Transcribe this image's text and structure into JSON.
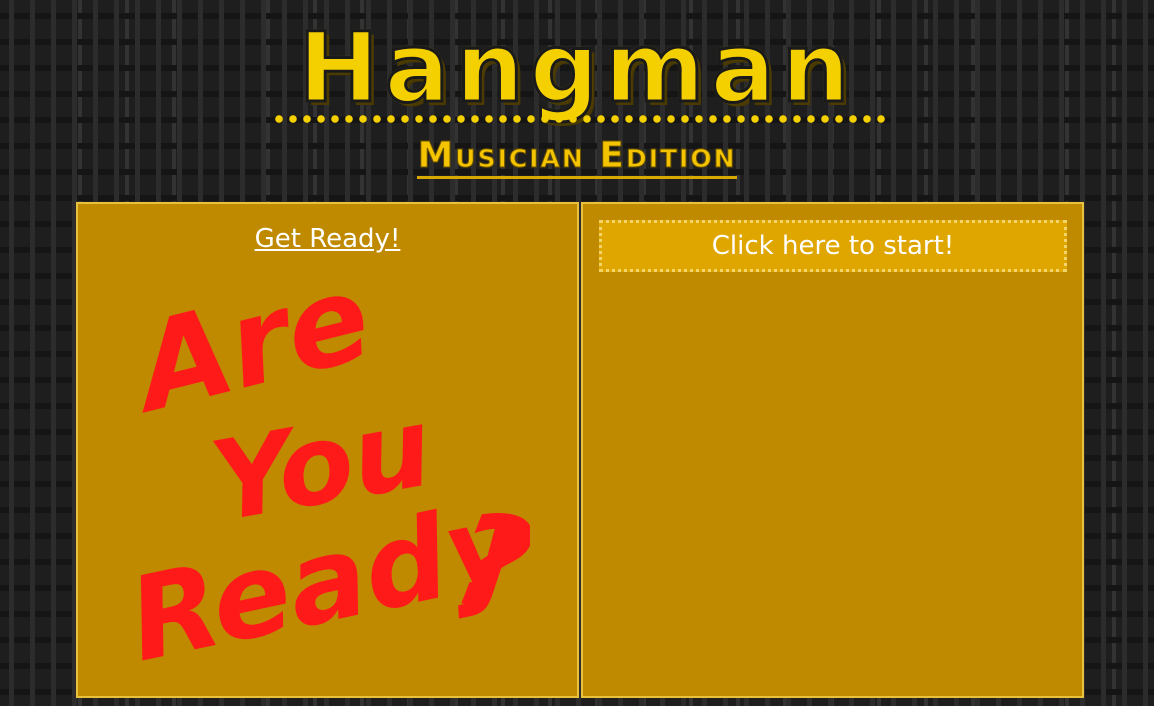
{
  "header": {
    "title": "Hangman",
    "subtitle": "Musician Edition"
  },
  "left_panel": {
    "link_label": "Get Ready!",
    "art_lines": [
      "Are",
      "You",
      "Ready",
      "?"
    ]
  },
  "right_panel": {
    "start_label": "Click here to start!"
  },
  "colors": {
    "panel": "#c08a00",
    "title": "#f5d000",
    "start_box": "#e0a600",
    "art_text": "#ff1a1a"
  }
}
